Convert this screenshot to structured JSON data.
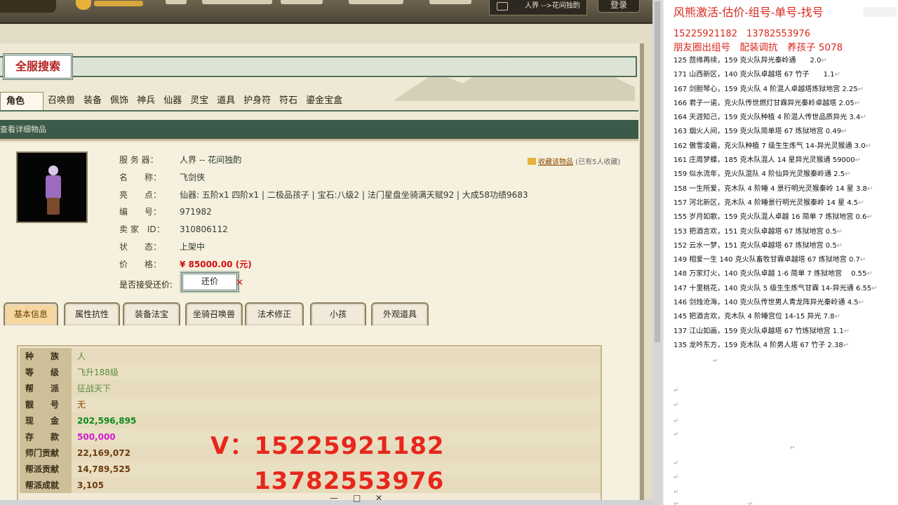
{
  "site": {
    "server_label": "人界 -->花间独酌",
    "login_label": "登录"
  },
  "search": {
    "title": "全服搜索"
  },
  "category_tabs": [
    "角色",
    "召唤兽",
    "装备",
    "佩饰",
    "神兵",
    "仙器",
    "灵宝",
    "道具",
    "护身符",
    "符石",
    "鎏金宝盒"
  ],
  "section_header": "查看详细物品",
  "item": {
    "rows": [
      {
        "key": "服 务 器：",
        "value": "人界 -- 花间独酌"
      },
      {
        "key": "名　　称：",
        "value": "飞剑侠"
      },
      {
        "key": "亮　　点：",
        "value": "仙器: 五阶x1 四阶x1 | 二极品孩子 | 宝石:八级2 | 法门星盘坐骑满天赋92 | 大成58功绩9683"
      },
      {
        "key": "编　　号：",
        "value": "971982"
      },
      {
        "key": "卖 家　ID：",
        "value": "310806112"
      },
      {
        "key": "状　　态：",
        "value": "上架中"
      },
      {
        "key": "价　　格：",
        "value": "¥ 85000.00 (元)"
      }
    ],
    "collect_link": "收藏该物品",
    "collect_count": "(已有5人收藏)",
    "counter_offer_label": "是否接受还价:",
    "counter_offer_button": "还价",
    "counter_offer_mark": "✕"
  },
  "info_tabs": [
    "基本信息",
    "属性抗性",
    "装备法宝",
    "坐骑召唤兽",
    "法术修正",
    "小孩",
    "外观道具"
  ],
  "attributes": [
    {
      "key": "种　　族",
      "value": "人",
      "color": "#5b8b3a"
    },
    {
      "key": "等　　级",
      "value": "飞升188级",
      "color": "#5b8b3a"
    },
    {
      "key": "帮　　派",
      "value": "征战天下",
      "color": "#5b8b3a"
    },
    {
      "key": "靓　　号",
      "value": "无",
      "color": "#8a4a00"
    },
    {
      "key": "现　　金",
      "value": "202,596,895",
      "color": "#0a8a1a"
    },
    {
      "key": "存　　款",
      "value": "500,000",
      "color": "#d21dd2"
    },
    {
      "key": "师门贡献",
      "value": "22,169,072",
      "color": "#6b3b0b"
    },
    {
      "key": "帮派贡献",
      "value": "14,789,525",
      "color": "#6b3b0b"
    },
    {
      "key": "帮派成就",
      "value": "3,105",
      "color": "#6b3b0b"
    }
  ],
  "overlay": {
    "line1": "V：15225921182",
    "line2": "13782553976"
  },
  "window_controls": [
    "—",
    "□",
    "✕"
  ],
  "doc": {
    "title": "风熊激活-估价-组号-单号-找号",
    "phones": "15225921182　13782553976",
    "subtitle": "朋友圈出组号　配装调抗　养孩子 5078",
    "lines": [
      "125 茴缘再续，159 克火队异光秦岭通　　2.0",
      "171 山西新区，140 克火队卓越塔 67 竹子　　1.1",
      "167 剑胆琴心，159 克火队 4 阶混人卓越塔炼狱地宫 2.25",
      "166 君子一诺，克火队传世燃灯甘霖异光秦岭卓越塔 2.05",
      "164 天涯知己，159 克火队种植 4 阶混人传世品质异光 3.4",
      "163 烟火人间，159 克火队简单塔 67 炼狱地宫 0.49",
      "162 傲雪凌霜，克火队种植 7 级生生炼气 14-异光灵猴通 3.0",
      "161 庄周梦蝶，185 克木队混人 14 星异光灵猴通 59000",
      "159 似水流年，克火队混队 4 阶仙异光灵猴秦岭通 2.5",
      "158 一生所爱，克木队 4 阶睡 4 景行明光灵猴秦岭 14 星 3.8",
      "157 河北新区，克木队 4 阶睡景行明光灵猴秦岭 14 星 4.5",
      "155 岁月如歌，159 克火队混人卓越 16 简单 7 炼狱地宫 0.6",
      "153 把酒言欢，151 克火队卓越塔 67 炼狱地宫 0.5",
      "152 云水一梦，151 克火队卓越塔 67 炼狱地宫 0.5",
      "149 相爱一生 140 克火队畜牧甘霖卓越塔 67 炼狱地宫 0.7",
      "148 万家灯火，140 克火队卓越 1-6 简单 7 炼狱地宫　 0.55",
      "147 十里桃花，140 克火队 5 级生生炼气甘霖 14-异光通 6.55",
      "146 剑烛沧海，140 克火队传世男人青龙阵异光秦岭通 4.5",
      "145 把酒言欢，克木队 4 阶睡宫位 14-15 异光 7.8",
      "137 江山如画，159 克火队卓越塔 67 竹炼狱地宫 1.1",
      "135 龙吟东方，159 克木队 4 阶男人塔 67 竹子 2.38"
    ],
    "return_mark": "↵"
  }
}
